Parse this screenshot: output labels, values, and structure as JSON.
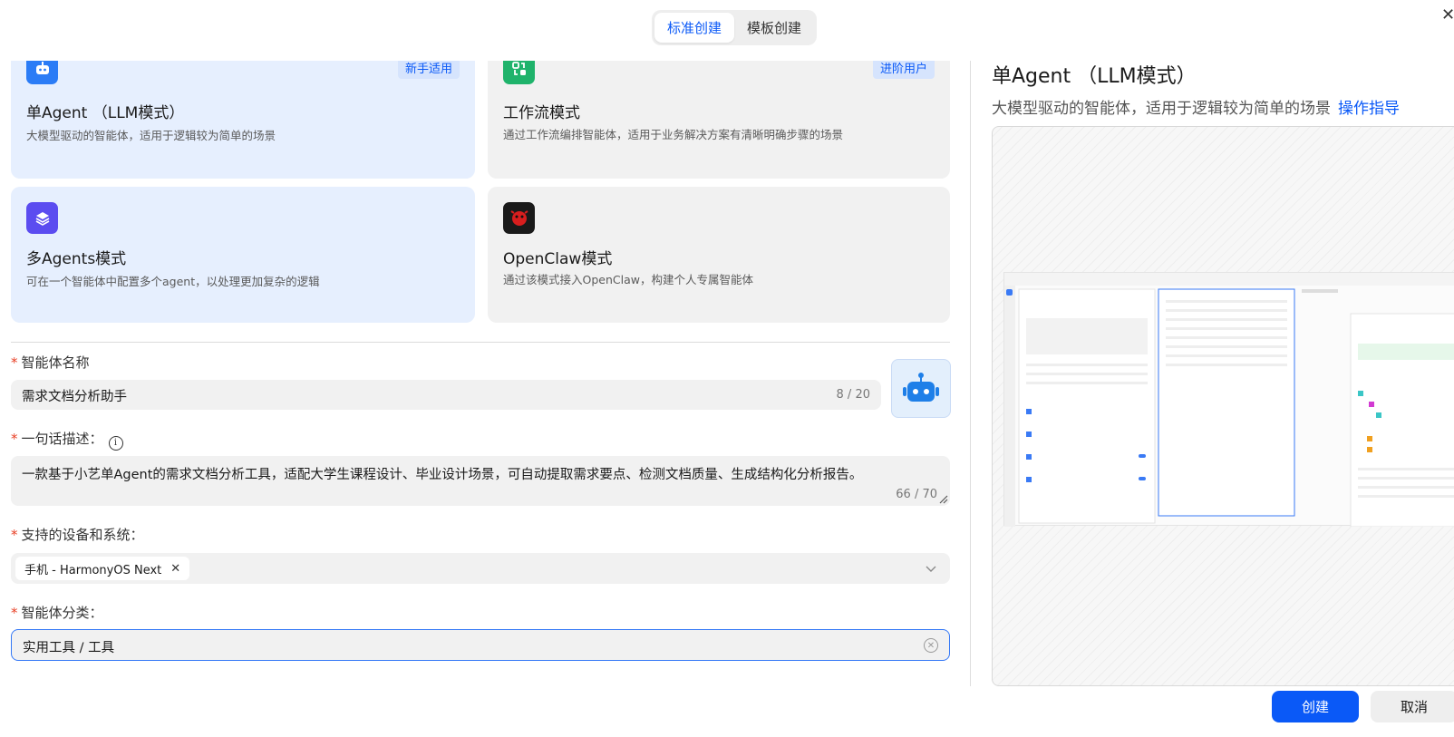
{
  "tabs": [
    {
      "label": "标准创建",
      "active": true
    },
    {
      "label": "模板创建",
      "active": false
    }
  ],
  "close_icon": "close-icon",
  "modes": [
    {
      "title": "单Agent （LLM模式）",
      "desc": "大模型驱动的智能体，适用于逻辑较为简单的场景",
      "tag": "新手适用",
      "icon": "robot-icon",
      "icon_color": "#2b7cf6",
      "selected": true
    },
    {
      "title": "工作流模式",
      "desc": "通过工作流编排智能体，适用于业务解决方案有清晰明确步骤的场景",
      "tag": "进阶用户",
      "icon": "workflow-icon",
      "icon_color": "#1fb36b",
      "selected": false
    },
    {
      "title": "多Agents模式",
      "desc": "可在一个智能体中配置多个agent，以处理更加复杂的逻辑",
      "tag": "",
      "icon": "layers-icon",
      "icon_color": "#5b4cf0",
      "selected": true
    },
    {
      "title": "OpenClaw模式",
      "desc": "通过该模式接入OpenClaw，构建个人专属智能体",
      "tag": "",
      "icon": "openclaw-icon",
      "icon_color": "#c61a1a",
      "selected": false
    }
  ],
  "form": {
    "name_label": "智能体名称",
    "name_value": "需求文档分析助手",
    "name_count": "8 / 20",
    "desc_label": "一句话描述：",
    "desc_value": "一款基于小艺单Agent的需求文档分析工具，适配大学生课程设计、毕业设计场景，可自动提取需求要点、检测文档质量、生成结构化分析报告。",
    "desc_count": "66 / 70",
    "device_label": "支持的设备和系统：",
    "device_chip": "手机 - HarmonyOS Next",
    "category_label": "智能体分类：",
    "category_value": "实用工具 / 工具"
  },
  "preview": {
    "title": "单Agent （LLM模式）",
    "desc": "大模型驱动的智能体，适用于逻辑较为简单的场景",
    "link": "操作指导"
  },
  "actions": {
    "create": "创建",
    "cancel": "取消"
  },
  "accent": "#0a59f7"
}
